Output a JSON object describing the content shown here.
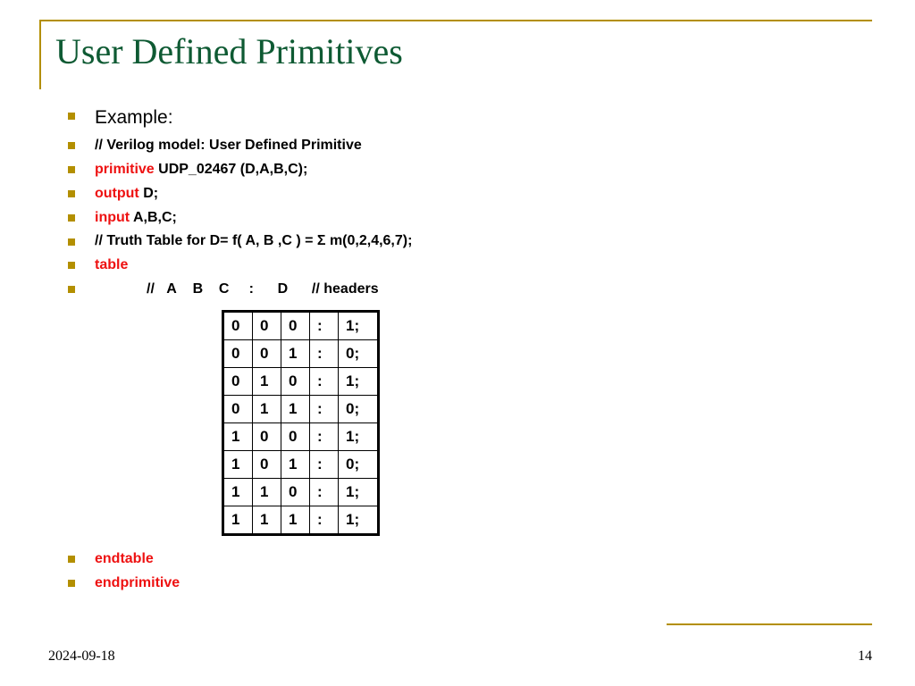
{
  "colors": {
    "accent": "#b38f00",
    "title": "#0e5a33",
    "keyword": "#e11"
  },
  "title": "User Defined Primitives",
  "bullets": [
    {
      "type": "plain-first",
      "text": "Example:"
    },
    {
      "type": "comment",
      "text": "// Verilog model: User Defined Primitive"
    },
    {
      "type": "kw",
      "keyword": "primitive",
      "rest": " UDP_02467 (D,A,B,C);"
    },
    {
      "type": "kw",
      "keyword": "output",
      "rest": " D;"
    },
    {
      "type": "kw",
      "keyword": "input",
      "rest": " A,B,C;"
    },
    {
      "type": "comment",
      "text": "// Truth Table for D= f( A, B ,C ) = Σ m(0,2,4,6,7);"
    },
    {
      "type": "kwonly",
      "keyword": "table"
    },
    {
      "type": "header",
      "text": "//   A    B    C     :      D      // headers"
    }
  ],
  "post_bullets": [
    {
      "type": "kwonly",
      "keyword": "endtable"
    },
    {
      "type": "kwonly",
      "keyword": "endprimitive"
    }
  ],
  "truth_table": [
    [
      "0",
      "0",
      "0",
      ":",
      "1;"
    ],
    [
      "0",
      "0",
      "1",
      ":",
      "0;"
    ],
    [
      "0",
      "1",
      "0",
      ":",
      "1;"
    ],
    [
      "0",
      "1",
      "1",
      ":",
      "0;"
    ],
    [
      "1",
      "0",
      "0",
      ":",
      "1;"
    ],
    [
      "1",
      "0",
      "1",
      ":",
      "0;"
    ],
    [
      "1",
      "1",
      "0",
      ":",
      "1;"
    ],
    [
      "1",
      "1",
      "1",
      ":",
      "1;"
    ]
  ],
  "footer": {
    "date": "2024-09-18",
    "page": "14"
  },
  "chart_data": {
    "type": "table",
    "title": "Truth table for UDP_02467",
    "columns": [
      "A",
      "B",
      "C",
      ":",
      "D"
    ],
    "rows": [
      [
        "0",
        "0",
        "0",
        ":",
        "1"
      ],
      [
        "0",
        "0",
        "1",
        ":",
        "0"
      ],
      [
        "0",
        "1",
        "0",
        ":",
        "1"
      ],
      [
        "0",
        "1",
        "1",
        ":",
        "0"
      ],
      [
        "1",
        "0",
        "0",
        ":",
        "1"
      ],
      [
        "1",
        "0",
        "1",
        ":",
        "0"
      ],
      [
        "1",
        "1",
        "0",
        ":",
        "1"
      ],
      [
        "1",
        "1",
        "1",
        ":",
        "1"
      ]
    ]
  }
}
